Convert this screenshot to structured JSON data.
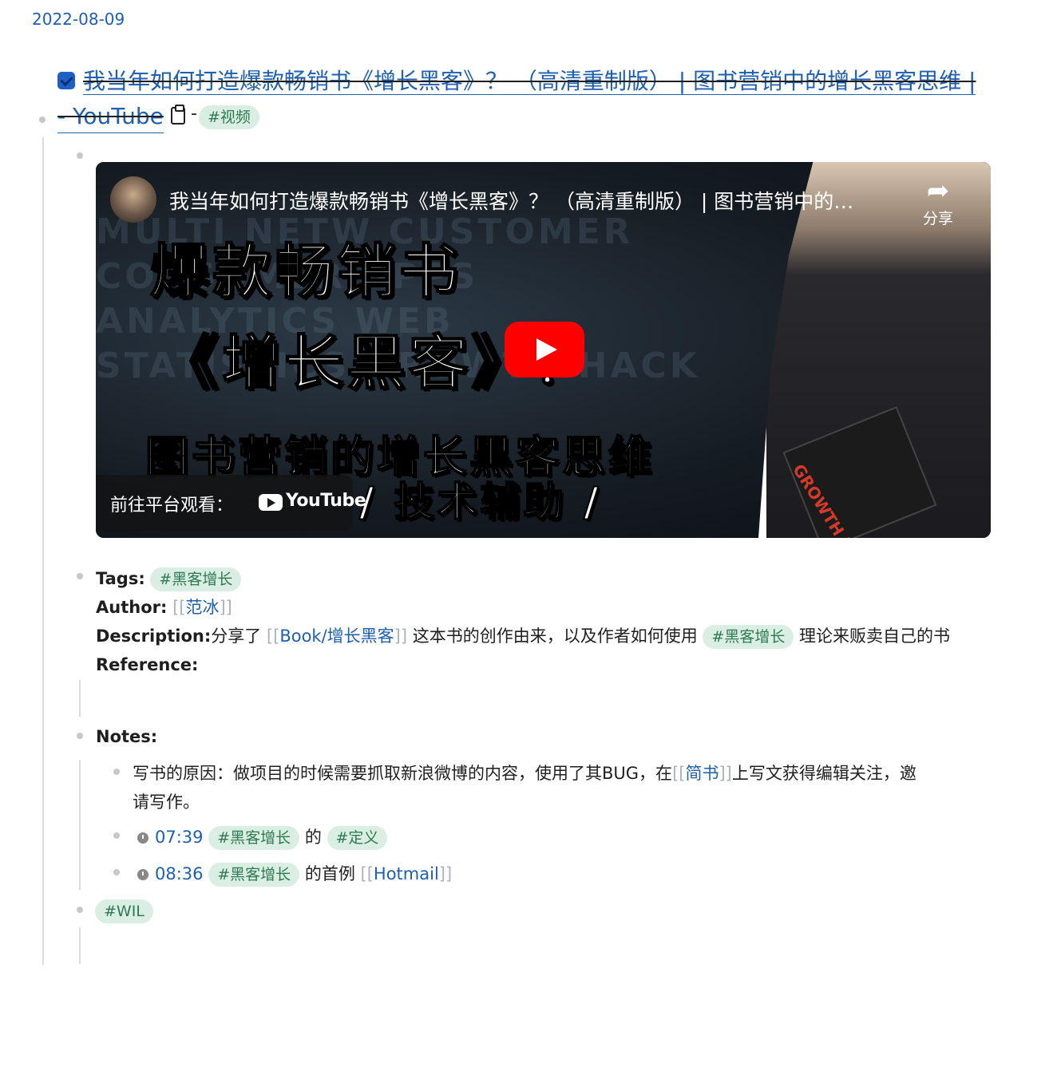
{
  "date": "2022-08-09",
  "block": {
    "title_line1": "我当年如何打造爆款畅销书《增长黑客》？ （高清重制版） | 图书营销中的增长黑客思维 |",
    "title_line2": "- YouTube",
    "dash": "-",
    "tag": "#视频"
  },
  "video": {
    "title": "我当年如何打造爆款畅销书《增长黑客》？ （高清重制版） | 图书营销中的…",
    "share_label": "分享",
    "watch_label": "前往平台观看：",
    "youtube_word": "YouTube",
    "thumb_line1": "爆款畅销书",
    "thumb_line2": "《增长黑客》？",
    "thumb_line3": "图书营销的增长黑客思维",
    "thumb_line4": "/  技术辅助  /",
    "book_title": "GROWTH HACKER 增长黑客",
    "bg_words": "MULTI NETW CUSTOMER CONSUMER APPS ANALYTICS WEB STATISTICS GROWTH HACK"
  },
  "props": {
    "tags_label": "Tags:",
    "tags_value": "#黑客增长",
    "author_label": "Author:",
    "author_open": "[[",
    "author_value": "范冰",
    "author_close": "]]",
    "desc_label": "Description:",
    "desc_pre": "分享了",
    "desc_link": "Book/增长黑客",
    "desc_mid": "这本书的创作由来，以及作者如何使用",
    "desc_tag": "#黑客增长",
    "desc_post": "理论来贩卖自己的书",
    "reference_label": "Reference:"
  },
  "notes": {
    "label": "Notes:",
    "item1_pre": "写书的原因：做项目的时候需要抓取新浪微博的内容，使用了其BUG，在",
    "item1_link": "简书",
    "item1_post": "上写文获得编辑关注，邀",
    "item1_line2": "请写作。",
    "item2_time": "07:39",
    "item2_tag1": "#黑客增长",
    "item2_mid": "的",
    "item2_tag2": "#定义",
    "item3_time": "08:36",
    "item3_tag": "#黑客增长",
    "item3_mid": "的首例",
    "item3_link": "Hotmail"
  },
  "footer_tag": "#WIL",
  "colors": {
    "link": "#1f5fb0",
    "tag_bg": "#dbeee3",
    "tag_text": "#2f7a52",
    "checkbox": "#1e5fc4"
  }
}
